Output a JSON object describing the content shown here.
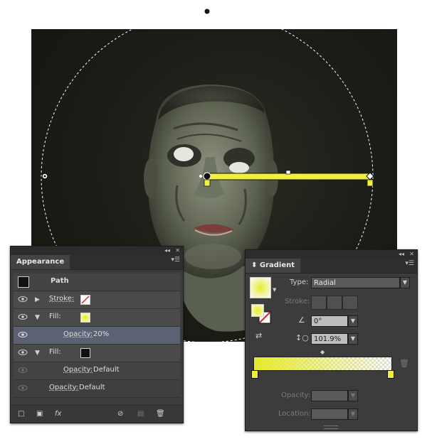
{
  "appearance": {
    "tab": "Appearance",
    "object_label": "Path",
    "rows": [
      {
        "label": "Stroke:",
        "value": ""
      },
      {
        "label": "Fill:",
        "value": ""
      },
      {
        "label": "Opacity:",
        "value": "20%"
      },
      {
        "label": "Fill:",
        "value": ""
      },
      {
        "label": "Opacity:",
        "value": "Default"
      },
      {
        "label": "Opacity:",
        "value": "Default"
      }
    ],
    "fx_label": "fx"
  },
  "gradient": {
    "tab": "Gradient",
    "type_label": "Type:",
    "type_value": "Radial",
    "stroke_label": "Stroke:",
    "angle_value": "0°",
    "aspect_value": "101.9%",
    "opacity_label": "Opacity:",
    "location_label": "Location:",
    "colors": {
      "start": "#e6ea2a",
      "end": "#ffffff"
    }
  },
  "colors": {
    "gradient_bar": "#f2ee3c",
    "selected_row": "#5b6273",
    "panel_bg": "#3c3c3c",
    "label_orange": "#f08a24"
  }
}
